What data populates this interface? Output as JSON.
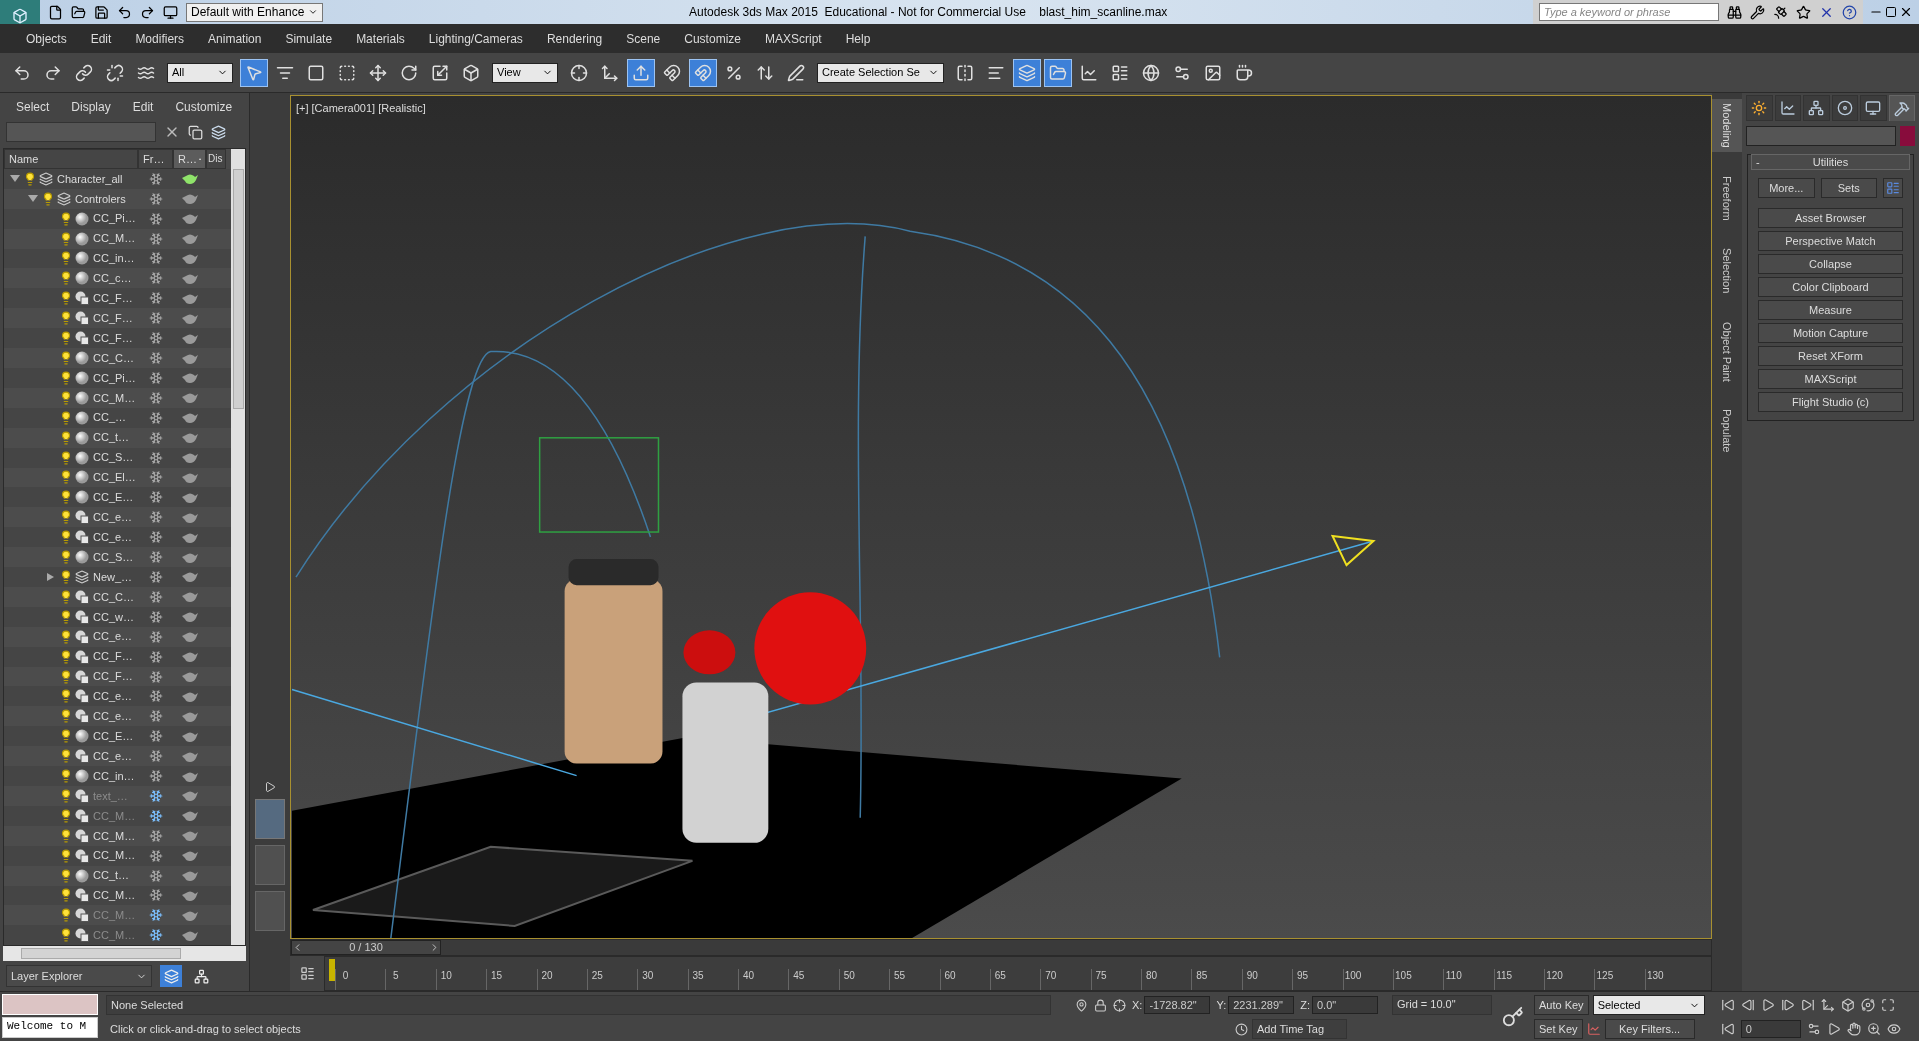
{
  "title_bar": {
    "workspace": "Default with Enhance",
    "title": "Autodesk 3ds Max 2015  Educational - Not for Commercial Use    blast_him_scanline.max",
    "search": {
      "placeholder": "Type a keyword or phrase"
    }
  },
  "menu": [
    "Objects",
    "Edit",
    "Modifiers",
    "Animation",
    "Simulate",
    "Materials",
    "Lighting/Cameras",
    "Rendering",
    "Scene",
    "Customize",
    "MAXScript",
    "Help"
  ],
  "toolbar": [
    {
      "kind": "button",
      "active": false
    },
    {
      "kind": "button",
      "active": false
    },
    {
      "kind": "button",
      "active": false
    },
    {
      "kind": "button",
      "active": false
    },
    {
      "kind": "button",
      "active": false
    },
    {
      "kind": "dropdown",
      "value": "All"
    },
    {
      "kind": "button",
      "active": true
    },
    {
      "kind": "button",
      "active": false
    },
    {
      "kind": "button",
      "active": false
    },
    {
      "kind": "button",
      "active": false
    },
    {
      "kind": "button",
      "active": false
    },
    {
      "kind": "button",
      "active": false
    },
    {
      "kind": "button",
      "active": false
    },
    {
      "kind": "button",
      "active": false
    },
    {
      "kind": "dropdown",
      "value": "View"
    },
    {
      "kind": "button",
      "active": false
    },
    {
      "kind": "button",
      "active": false
    },
    {
      "kind": "button",
      "active": true
    },
    {
      "kind": "button",
      "active": false
    },
    {
      "kind": "button",
      "active": true
    },
    {
      "kind": "button",
      "active": false
    },
    {
      "kind": "button",
      "active": false
    },
    {
      "kind": "button",
      "active": false
    },
    {
      "kind": "dropdown",
      "value": "Create Selection Se"
    },
    {
      "kind": "button",
      "active": false
    },
    {
      "kind": "button",
      "active": false
    },
    {
      "kind": "button",
      "active": true
    },
    {
      "kind": "button",
      "active": true
    },
    {
      "kind": "button",
      "active": false
    },
    {
      "kind": "button",
      "active": false
    },
    {
      "kind": "button",
      "active": false
    },
    {
      "kind": "button",
      "active": false
    },
    {
      "kind": "button",
      "active": false
    },
    {
      "kind": "button",
      "active": false
    }
  ],
  "scene_explorer": {
    "menu": [
      "Select",
      "Display",
      "Edit",
      "Customize"
    ],
    "columns": [
      {
        "label": "Name",
        "sorted": false
      },
      {
        "label": "Fr…",
        "sorted": false
      },
      {
        "label": "R…",
        "sorted": true
      },
      {
        "label": "Dis",
        "sorted": false
      }
    ],
    "tree": [
      {
        "name": "Character_all",
        "kind": "layer",
        "expanded": true,
        "current": true,
        "frozen": false,
        "children": [
          {
            "name": "Controlers",
            "kind": "layer",
            "expanded": true,
            "current": false,
            "frozen": false,
            "children": [
              {
                "name": "CC_Pi…",
                "kind": "sphere",
                "frozen": false
              },
              {
                "name": "CC_M…",
                "kind": "sphere",
                "frozen": false
              },
              {
                "name": "CC_in…",
                "kind": "sphere",
                "frozen": false
              },
              {
                "name": "CC_c…",
                "kind": "sphere",
                "frozen": false
              },
              {
                "name": "CC_F…",
                "kind": "shape",
                "frozen": false
              },
              {
                "name": "CC_F…",
                "kind": "shape",
                "frozen": false
              },
              {
                "name": "CC_F…",
                "kind": "shape",
                "frozen": false
              },
              {
                "name": "CC_C…",
                "kind": "sphere",
                "frozen": false
              },
              {
                "name": "CC_Pi…",
                "kind": "sphere",
                "frozen": false
              },
              {
                "name": "CC_M…",
                "kind": "sphere",
                "frozen": false
              },
              {
                "name": "CC_…",
                "kind": "sphere",
                "frozen": false
              },
              {
                "name": "CC_t…",
                "kind": "sphere",
                "frozen": false
              },
              {
                "name": "CC_S…",
                "kind": "sphere",
                "frozen": false
              },
              {
                "name": "CC_El…",
                "kind": "sphere",
                "frozen": false
              },
              {
                "name": "CC_E…",
                "kind": "sphere",
                "frozen": false
              },
              {
                "name": "CC_e…",
                "kind": "shape",
                "frozen": false
              },
              {
                "name": "CC_e…",
                "kind": "shape",
                "frozen": false
              },
              {
                "name": "CC_S…",
                "kind": "sphere",
                "frozen": false
              },
              {
                "name": "New_…",
                "kind": "layer",
                "expanded": false,
                "current": false,
                "frozen": false
              },
              {
                "name": "CC_C…",
                "kind": "shape",
                "frozen": false
              },
              {
                "name": "CC_w…",
                "kind": "shape",
                "frozen": false
              },
              {
                "name": "CC_e…",
                "kind": "shape",
                "frozen": false
              },
              {
                "name": "CC_F…",
                "kind": "shape",
                "frozen": false
              },
              {
                "name": "CC_F…",
                "kind": "shape",
                "frozen": false
              },
              {
                "name": "CC_e…",
                "kind": "shape",
                "frozen": false
              },
              {
                "name": "CC_e…",
                "kind": "shape",
                "frozen": false
              },
              {
                "name": "CC_E…",
                "kind": "sphere",
                "frozen": false
              },
              {
                "name": "CC_e…",
                "kind": "shape",
                "frozen": false
              },
              {
                "name": "CC_in…",
                "kind": "sphere",
                "frozen": false
              },
              {
                "name": "text_…",
                "kind": "shape",
                "frozen": true
              },
              {
                "name": "CC_M…",
                "kind": "shape",
                "frozen": true
              },
              {
                "name": "CC_M…",
                "kind": "shape",
                "frozen": false
              },
              {
                "name": "CC_M…",
                "kind": "shape",
                "frozen": false
              },
              {
                "name": "CC_t…",
                "kind": "sphere",
                "frozen": false
              },
              {
                "name": "CC_M…",
                "kind": "shape",
                "frozen": false
              },
              {
                "name": "CC_M…",
                "kind": "shape",
                "frozen": true
              },
              {
                "name": "CC_M…",
                "kind": "shape",
                "frozen": true
              }
            ]
          }
        ]
      }
    ],
    "footer": {
      "mode": "Layer Explorer",
      "buttons": [
        {
          "selected": true
        },
        {
          "selected": false
        }
      ]
    }
  },
  "viewport": {
    "labels": [
      "[+]",
      "[Camera001]",
      "[Realistic]"
    ]
  },
  "layout_tabs": [
    {
      "selected": true
    },
    {
      "selected": false
    },
    {
      "selected": false
    }
  ],
  "ribbon_tabs": [
    {
      "label": "Modeling",
      "selected": true
    },
    {
      "label": "Freeform",
      "selected": false
    },
    {
      "label": "Selection",
      "selected": false
    },
    {
      "label": "Object Paint",
      "selected": false
    },
    {
      "label": "Populate",
      "selected": false
    }
  ],
  "command_panel": {
    "tabs": [
      {
        "selected": false
      },
      {
        "selected": false
      },
      {
        "selected": false
      },
      {
        "selected": false
      },
      {
        "selected": false
      },
      {
        "selected": true
      }
    ],
    "rollout": {
      "collapse": "-",
      "title": "Utilities",
      "top_buttons": [
        "More...",
        "Sets"
      ],
      "buttons": [
        "Asset Browser",
        "Perspective Match",
        "Collapse",
        "Color Clipboard",
        "Measure",
        "Motion Capture",
        "Reset XForm",
        "MAXScript",
        "Flight Studio (c)"
      ]
    }
  },
  "timeline": {
    "position": "0 / 130",
    "level": 0,
    "ticks": [
      "0",
      "5",
      "10",
      "15",
      "20",
      "25",
      "30",
      "35",
      "40",
      "45",
      "50",
      "55",
      "60",
      "65",
      "70",
      "75",
      "80",
      "85",
      "90",
      "95",
      "100",
      "105",
      "110",
      "115",
      "120",
      "125",
      "130"
    ]
  },
  "status_bar": {
    "listener": "Welcome to M",
    "selection": "None Selected",
    "prompt": "Click or click-and-drag to select objects",
    "coords": [
      {
        "axis": "X:",
        "value": "-1728.82\""
      },
      {
        "axis": "Y:",
        "value": "2231.289\""
      },
      {
        "axis": "Z:",
        "value": "0.0\""
      }
    ],
    "grid": "Grid = 10.0\"",
    "time_tag": "Add Time Tag",
    "auto_key": "Auto Key",
    "set_key": "Set Key",
    "key_set": "Selected",
    "key_filters": "Key Filters...",
    "frame": "0"
  }
}
